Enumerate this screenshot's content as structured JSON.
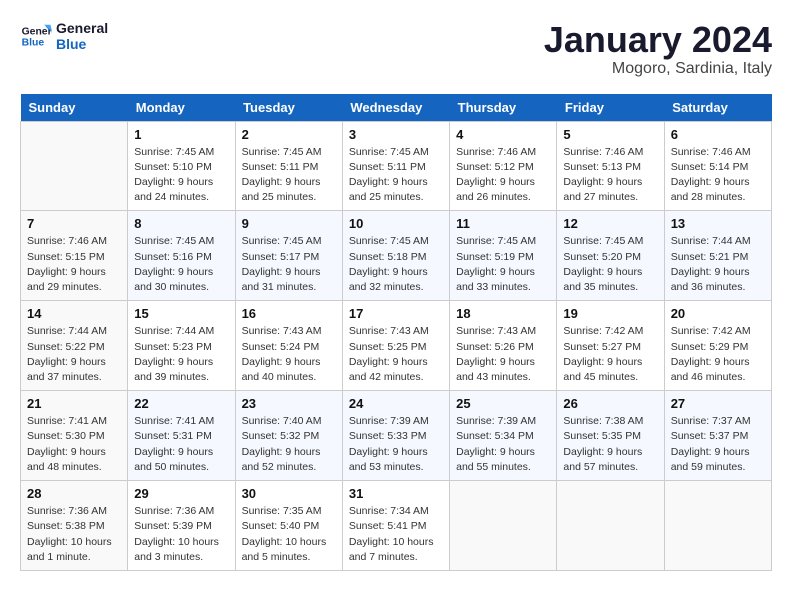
{
  "header": {
    "logo_line1": "General",
    "logo_line2": "Blue",
    "title": "January 2024",
    "subtitle": "Mogoro, Sardinia, Italy"
  },
  "days_of_week": [
    "Sunday",
    "Monday",
    "Tuesday",
    "Wednesday",
    "Thursday",
    "Friday",
    "Saturday"
  ],
  "weeks": [
    [
      {
        "day": "",
        "info": ""
      },
      {
        "day": "1",
        "info": "Sunrise: 7:45 AM\nSunset: 5:10 PM\nDaylight: 9 hours\nand 24 minutes."
      },
      {
        "day": "2",
        "info": "Sunrise: 7:45 AM\nSunset: 5:11 PM\nDaylight: 9 hours\nand 25 minutes."
      },
      {
        "day": "3",
        "info": "Sunrise: 7:45 AM\nSunset: 5:11 PM\nDaylight: 9 hours\nand 25 minutes."
      },
      {
        "day": "4",
        "info": "Sunrise: 7:46 AM\nSunset: 5:12 PM\nDaylight: 9 hours\nand 26 minutes."
      },
      {
        "day": "5",
        "info": "Sunrise: 7:46 AM\nSunset: 5:13 PM\nDaylight: 9 hours\nand 27 minutes."
      },
      {
        "day": "6",
        "info": "Sunrise: 7:46 AM\nSunset: 5:14 PM\nDaylight: 9 hours\nand 28 minutes."
      }
    ],
    [
      {
        "day": "7",
        "info": "Sunrise: 7:46 AM\nSunset: 5:15 PM\nDaylight: 9 hours\nand 29 minutes."
      },
      {
        "day": "8",
        "info": "Sunrise: 7:45 AM\nSunset: 5:16 PM\nDaylight: 9 hours\nand 30 minutes."
      },
      {
        "day": "9",
        "info": "Sunrise: 7:45 AM\nSunset: 5:17 PM\nDaylight: 9 hours\nand 31 minutes."
      },
      {
        "day": "10",
        "info": "Sunrise: 7:45 AM\nSunset: 5:18 PM\nDaylight: 9 hours\nand 32 minutes."
      },
      {
        "day": "11",
        "info": "Sunrise: 7:45 AM\nSunset: 5:19 PM\nDaylight: 9 hours\nand 33 minutes."
      },
      {
        "day": "12",
        "info": "Sunrise: 7:45 AM\nSunset: 5:20 PM\nDaylight: 9 hours\nand 35 minutes."
      },
      {
        "day": "13",
        "info": "Sunrise: 7:44 AM\nSunset: 5:21 PM\nDaylight: 9 hours\nand 36 minutes."
      }
    ],
    [
      {
        "day": "14",
        "info": "Sunrise: 7:44 AM\nSunset: 5:22 PM\nDaylight: 9 hours\nand 37 minutes."
      },
      {
        "day": "15",
        "info": "Sunrise: 7:44 AM\nSunset: 5:23 PM\nDaylight: 9 hours\nand 39 minutes."
      },
      {
        "day": "16",
        "info": "Sunrise: 7:43 AM\nSunset: 5:24 PM\nDaylight: 9 hours\nand 40 minutes."
      },
      {
        "day": "17",
        "info": "Sunrise: 7:43 AM\nSunset: 5:25 PM\nDaylight: 9 hours\nand 42 minutes."
      },
      {
        "day": "18",
        "info": "Sunrise: 7:43 AM\nSunset: 5:26 PM\nDaylight: 9 hours\nand 43 minutes."
      },
      {
        "day": "19",
        "info": "Sunrise: 7:42 AM\nSunset: 5:27 PM\nDaylight: 9 hours\nand 45 minutes."
      },
      {
        "day": "20",
        "info": "Sunrise: 7:42 AM\nSunset: 5:29 PM\nDaylight: 9 hours\nand 46 minutes."
      }
    ],
    [
      {
        "day": "21",
        "info": "Sunrise: 7:41 AM\nSunset: 5:30 PM\nDaylight: 9 hours\nand 48 minutes."
      },
      {
        "day": "22",
        "info": "Sunrise: 7:41 AM\nSunset: 5:31 PM\nDaylight: 9 hours\nand 50 minutes."
      },
      {
        "day": "23",
        "info": "Sunrise: 7:40 AM\nSunset: 5:32 PM\nDaylight: 9 hours\nand 52 minutes."
      },
      {
        "day": "24",
        "info": "Sunrise: 7:39 AM\nSunset: 5:33 PM\nDaylight: 9 hours\nand 53 minutes."
      },
      {
        "day": "25",
        "info": "Sunrise: 7:39 AM\nSunset: 5:34 PM\nDaylight: 9 hours\nand 55 minutes."
      },
      {
        "day": "26",
        "info": "Sunrise: 7:38 AM\nSunset: 5:35 PM\nDaylight: 9 hours\nand 57 minutes."
      },
      {
        "day": "27",
        "info": "Sunrise: 7:37 AM\nSunset: 5:37 PM\nDaylight: 9 hours\nand 59 minutes."
      }
    ],
    [
      {
        "day": "28",
        "info": "Sunrise: 7:36 AM\nSunset: 5:38 PM\nDaylight: 10 hours\nand 1 minute."
      },
      {
        "day": "29",
        "info": "Sunrise: 7:36 AM\nSunset: 5:39 PM\nDaylight: 10 hours\nand 3 minutes."
      },
      {
        "day": "30",
        "info": "Sunrise: 7:35 AM\nSunset: 5:40 PM\nDaylight: 10 hours\nand 5 minutes."
      },
      {
        "day": "31",
        "info": "Sunrise: 7:34 AM\nSunset: 5:41 PM\nDaylight: 10 hours\nand 7 minutes."
      },
      {
        "day": "",
        "info": ""
      },
      {
        "day": "",
        "info": ""
      },
      {
        "day": "",
        "info": ""
      }
    ]
  ]
}
